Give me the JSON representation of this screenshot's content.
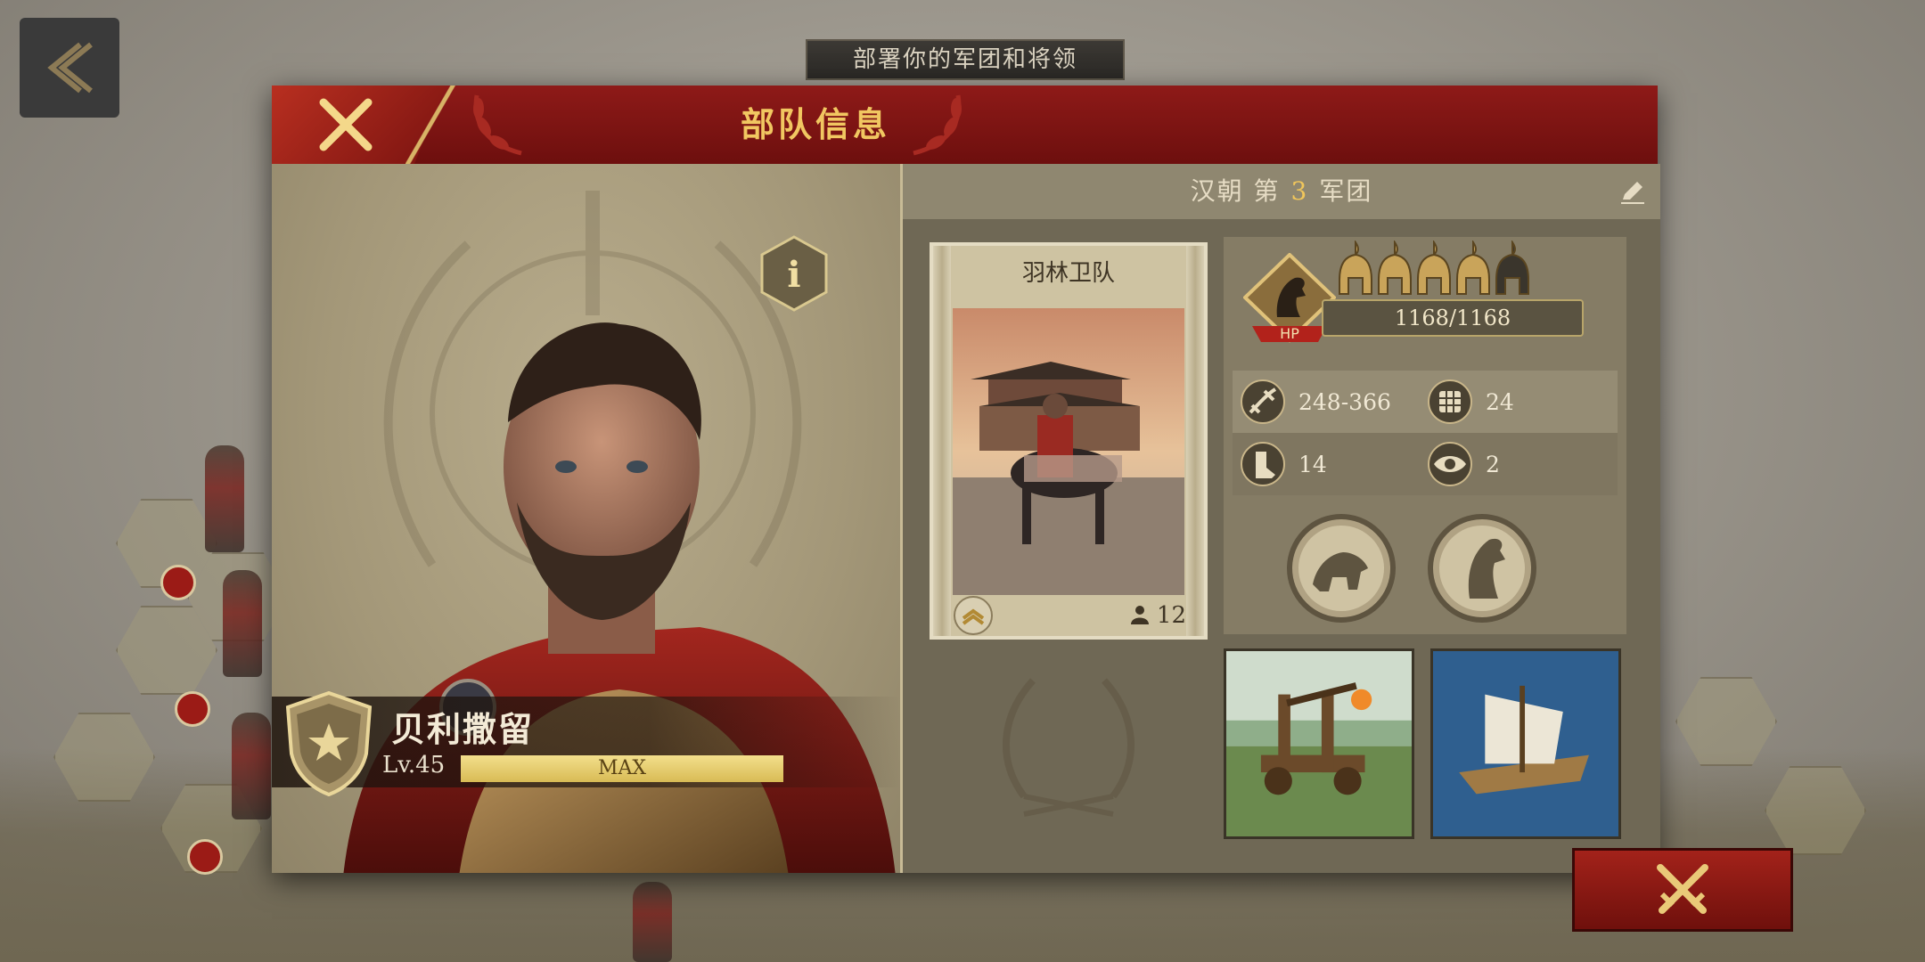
{
  "top_banner": "部署你的军团和将领",
  "dialog": {
    "title": "部队信息",
    "hero": {
      "name": "贝利撒留",
      "level": "Lv.45",
      "xp_label": "MAX"
    },
    "legion": {
      "prefix": "汉朝 第",
      "number": "3",
      "suffix": "军团"
    },
    "unit": {
      "name": "羽林卫队",
      "count": "12",
      "hp": "1168/1168",
      "hp_label": "HP",
      "stars_filled": 4,
      "stars_total": 5,
      "stats": [
        {
          "icon": "attack-icon",
          "value": "248-366"
        },
        {
          "icon": "defense-icon",
          "value": "24"
        },
        {
          "icon": "movement-icon",
          "value": "14"
        },
        {
          "icon": "vision-icon",
          "value": "2"
        }
      ],
      "skills": [
        "cavalry-charge-skill-icon",
        "horse-skill-icon"
      ]
    },
    "vehicles": [
      "catapult",
      "ship"
    ]
  },
  "colors": {
    "header_red": "#8e1a18",
    "gold": "#f1c761",
    "panel_tan": "#a39778"
  }
}
